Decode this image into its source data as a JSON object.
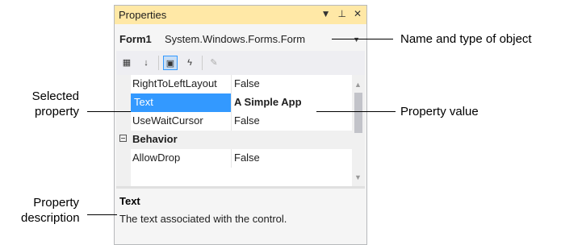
{
  "panel": {
    "title": "Properties",
    "icons": [
      "chevron-down-icon",
      "pin-icon",
      "close-icon"
    ],
    "object": {
      "name": "Form1",
      "type": "System.Windows.Forms.Form"
    },
    "rows": [
      {
        "name": "RightToLeftLayout",
        "value": "False"
      },
      {
        "name": "Text",
        "value": "A Simple App",
        "selected": true
      },
      {
        "name": "UseWaitCursor",
        "value": "False"
      },
      {
        "category": "Behavior"
      },
      {
        "name": "AllowDrop",
        "value": "False"
      }
    ],
    "description": {
      "heading": "Text",
      "text": "The text associated with the control."
    }
  },
  "callouts": {
    "name_type": "Name and type of object",
    "selected": [
      "Selected",
      "property"
    ],
    "value": "Property value",
    "description": [
      "Property",
      "description"
    ]
  }
}
